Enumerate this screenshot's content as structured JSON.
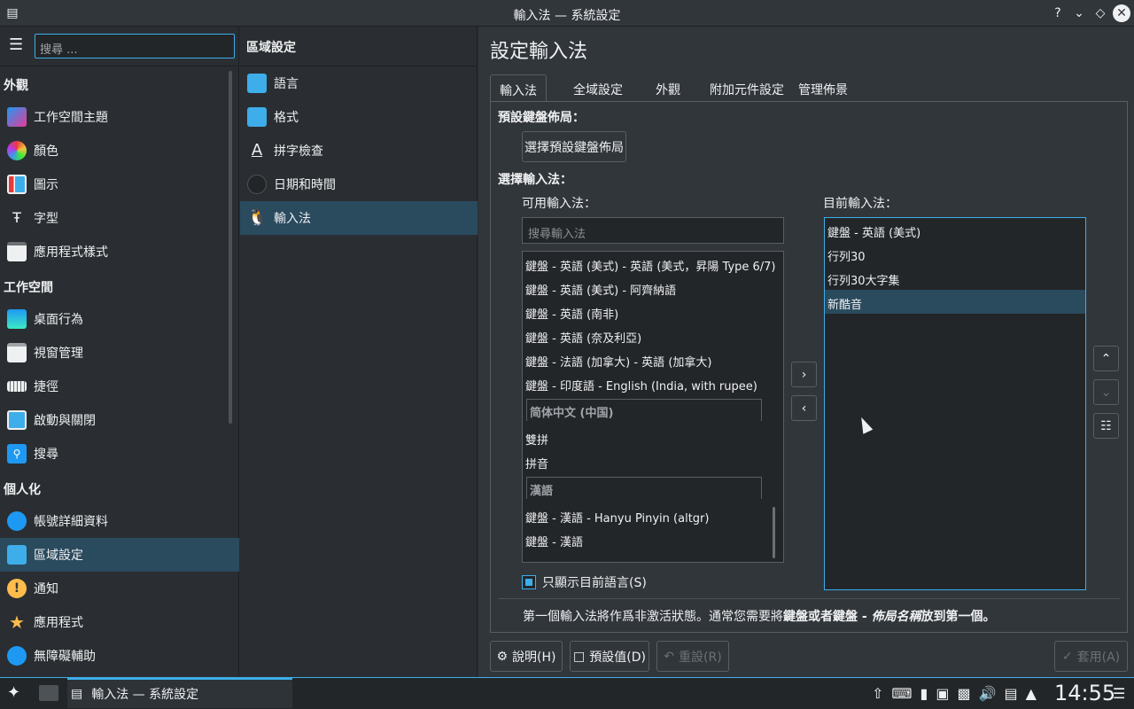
{
  "window": {
    "title": "輸入法 — 系統設定"
  },
  "sidebar": {
    "search_placeholder": "搜尋 ...",
    "sections": [
      {
        "label": "外觀"
      },
      {
        "label": "工作空間"
      },
      {
        "label": "個人化"
      }
    ],
    "items": [
      {
        "label": "工作空間主題"
      },
      {
        "label": "顏色"
      },
      {
        "label": "圖示"
      },
      {
        "label": "字型"
      },
      {
        "label": "應用程式樣式"
      },
      {
        "label": "桌面行為"
      },
      {
        "label": "視窗管理"
      },
      {
        "label": "捷徑"
      },
      {
        "label": "啟動與關閉"
      },
      {
        "label": "搜尋"
      },
      {
        "label": "帳號詳細資料"
      },
      {
        "label": "區域設定"
      },
      {
        "label": "通知"
      },
      {
        "label": "應用程式"
      },
      {
        "label": "無障礙輔助"
      }
    ]
  },
  "middle": {
    "title": "區域設定",
    "items": [
      {
        "label": "語言"
      },
      {
        "label": "格式"
      },
      {
        "label": "拼字檢查"
      },
      {
        "label": "日期和時間"
      },
      {
        "label": "輸入法"
      }
    ]
  },
  "page": {
    "title": "設定輸入法",
    "tabs": [
      {
        "label": "輸入法"
      },
      {
        "label": "全域設定"
      },
      {
        "label": "外觀"
      },
      {
        "label": "附加元件設定"
      },
      {
        "label": "管理佈景"
      }
    ],
    "default_layout_label": "預設鍵盤佈局：",
    "choose_layout_button": "選擇預設鍵盤佈局",
    "choose_im_label": "選擇輸入法：",
    "available_label": "可用輸入法：",
    "current_label": "目前輸入法：",
    "search_placeholder": "搜尋輸入法",
    "available": [
      "鍵盤 - 英語 (美式) - 英語 (美式，昇陽 Type 6/7)",
      "鍵盤 - 英語 (美式) - 阿齊納語",
      "鍵盤 - 英語 (南非)",
      "鍵盤 - 英語 (奈及利亞)",
      "鍵盤 - 法語 (加拿大) - 英語 (加拿大)",
      "鍵盤 - 印度語 - English (India, with rupee)"
    ],
    "group1": "简体中文 (中国)",
    "group1_items": [
      "雙拼",
      "拼音"
    ],
    "group2": "漢語",
    "group2_items": [
      "鍵盤 - 漢語 - Hanyu Pinyin (altgr)",
      "鍵盤 - 漢語"
    ],
    "current": [
      "鍵盤 - 英語 (美式)",
      "行列30",
      "行列30大字集",
      "新酷音"
    ],
    "show_current_lang": "只顯示目前語言(S)",
    "show_current_lang_checked": true,
    "hint_part1": "第一個輸入法將作爲非激活狀態。通常您需要將",
    "hint_bold1": "鍵盤或者鍵盤 - ",
    "hint_italic": "佈局名稱",
    "hint_part2": "放到第一個。"
  },
  "footer": {
    "help": "說明(H)",
    "defaults": "預設值(D)",
    "reset": "重設(R)",
    "apply": "套用(A)"
  },
  "taskbar": {
    "task_label": "輸入法 — 系統設定",
    "clock": "14:55"
  },
  "colors": {
    "accent": "#3daee9",
    "selection": "#2a4a5e"
  }
}
